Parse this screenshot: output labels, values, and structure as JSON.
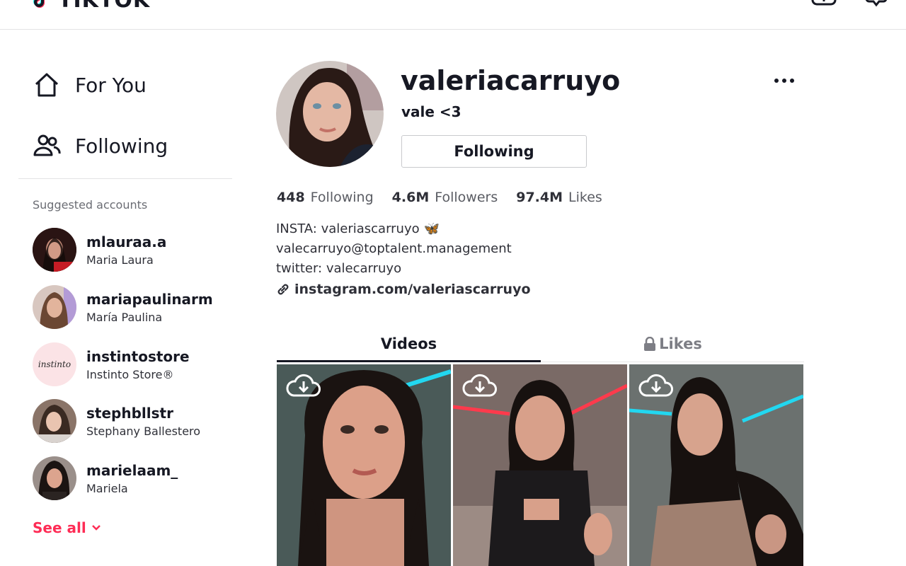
{
  "app": {
    "logo_text": "TIKTOK"
  },
  "sidebar": {
    "nav": [
      {
        "label": "For You",
        "icon": "home-icon"
      },
      {
        "label": "Following",
        "icon": "users-icon"
      }
    ],
    "suggested_title": "Suggested accounts",
    "accounts": [
      {
        "username": "mlauraa.a",
        "name": "Maria Laura"
      },
      {
        "username": "mariapaulinarm",
        "name": "María Paulina"
      },
      {
        "username": "instintostore",
        "name": "Instinto Store®",
        "logo_text": "instinto"
      },
      {
        "username": "stephbllstr",
        "name": "Stephany Ballestero"
      },
      {
        "username": "marielaam_",
        "name": "Mariela"
      }
    ],
    "see_all": "See all"
  },
  "profile": {
    "username": "valeriacarruyo",
    "nickname": "vale <3",
    "follow_button": "Following",
    "stats": {
      "following_count": "448",
      "following_label": "Following",
      "followers_count": "4.6M",
      "followers_label": "Followers",
      "likes_count": "97.4M",
      "likes_label": "Likes"
    },
    "bio": {
      "line1": "INSTA: valeriascarruyo",
      "line1_emoji": "🦋",
      "line2": "valecarruyo@toptalent.management",
      "line3": "twitter: valecarruyo"
    },
    "link": "instagram.com/valeriascarruyo"
  },
  "tabs": {
    "videos": "Videos",
    "likes": "Likes"
  },
  "colors": {
    "accent": "#fe2c55",
    "text": "#161823",
    "divider": "#e3e3e4"
  }
}
